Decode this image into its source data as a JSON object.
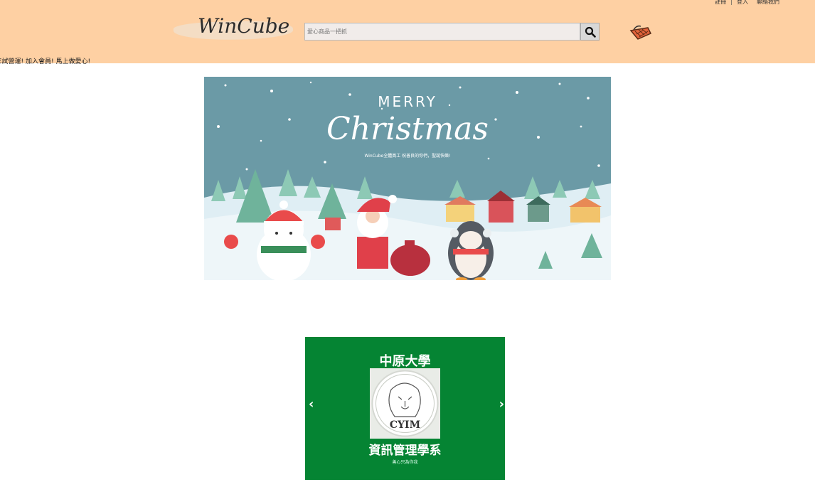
{
  "header": {
    "top_links": [
      "註冊",
      "登入",
      "聯絡我們"
    ],
    "logo_text": "WinCube",
    "search_placeholder": "愛心商品一把抓",
    "marquee": "ℇ試營運! 加入會員! 馬上做愛心!"
  },
  "banner": {
    "heading_small": "MERRY",
    "heading_large": "Christmas",
    "tagline": "WinCube全體員工 祝善良的你們，聖誕快樂!"
  },
  "carousel": {
    "title": "中原大學",
    "emblem_text": "CYIM",
    "department": "資訊管理學系",
    "subtitle": "善心只為你我",
    "prev_arrow": "‹",
    "next_arrow": "›"
  },
  "colors": {
    "header_bg": "#fed0a3",
    "banner_sky": "#6b9aa6",
    "carousel_bg": "#058433"
  }
}
